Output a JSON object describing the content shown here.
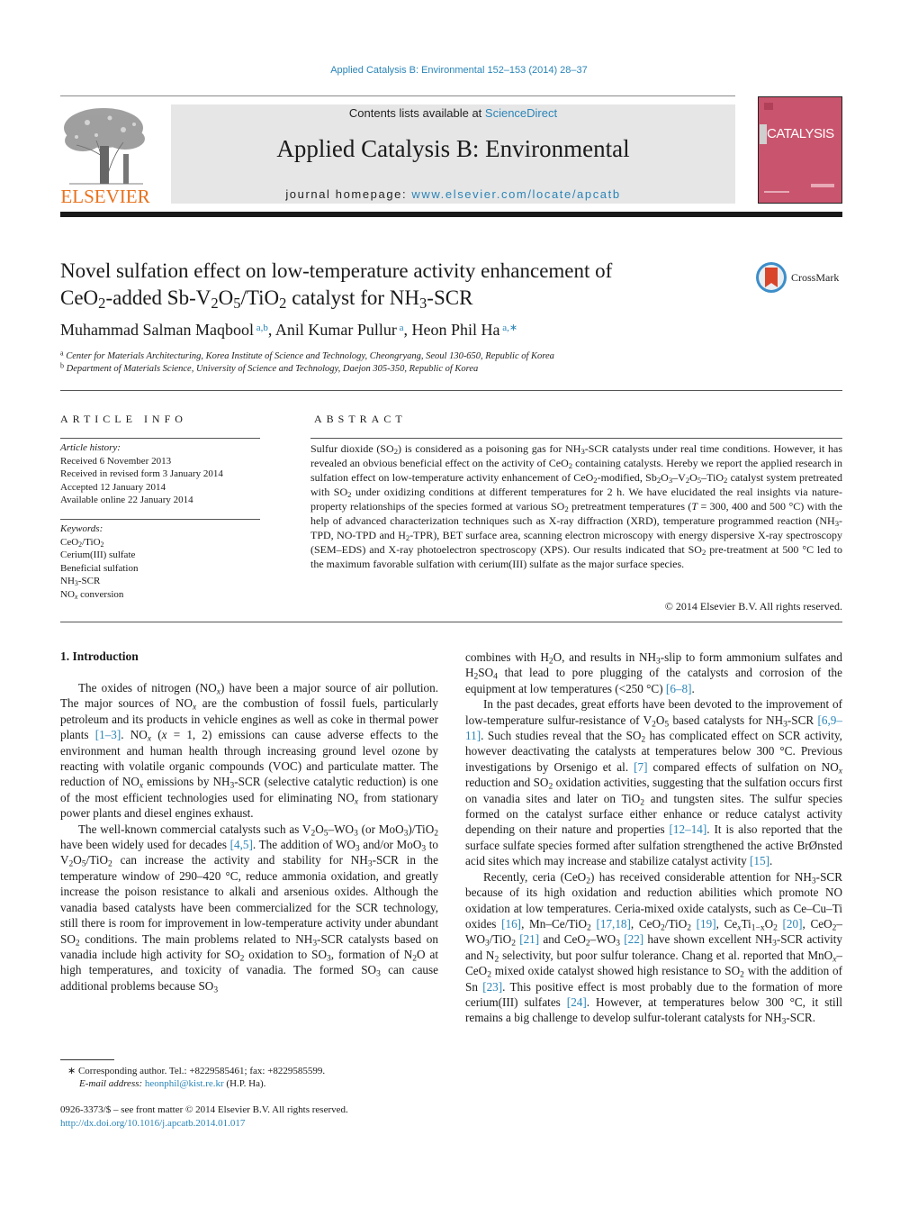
{
  "header": {
    "citation": "Applied Catalysis B: Environmental 152–153 (2014) 28–37",
    "contents_prefix": "Contents lists available at ",
    "contents_link": "ScienceDirect",
    "journal_title": "Applied Catalysis B: Environmental",
    "homepage_prefix": "journal homepage: ",
    "homepage_link": "www.elsevier.com/locate/apcatb",
    "publisher_logo_text": "ELSEVIER",
    "cover_title": "CATALYSIS",
    "crossmark_label": "CrossMark"
  },
  "colors": {
    "link": "#2a85b8",
    "elsevier_orange": "#e9711c",
    "cover_pink": "#c9546d",
    "masthead_gray": "#e6e6e6"
  },
  "article": {
    "title_line1": [
      {
        "t": "Novel sulfation effect on low-temperature activity enhancement of"
      }
    ],
    "title_line2": [
      {
        "t": "CeO"
      },
      {
        "t": "2",
        "sub": true
      },
      {
        "t": "-added Sb-V"
      },
      {
        "t": "2",
        "sub": true
      },
      {
        "t": "O"
      },
      {
        "t": "5",
        "sub": true
      },
      {
        "t": "/TiO"
      },
      {
        "t": "2",
        "sub": true
      },
      {
        "t": " catalyst for NH"
      },
      {
        "t": "3",
        "sub": true
      },
      {
        "t": "-SCR"
      }
    ],
    "authors": [
      {
        "t": "Muhammad Salman Maqbool"
      },
      {
        "t": " a,b",
        "sup": true
      },
      {
        "t": ", Anil Kumar Pullur"
      },
      {
        "t": " a",
        "sup": true
      },
      {
        "t": ", Heon Phil Ha"
      },
      {
        "t": " a,∗",
        "sup": true
      }
    ],
    "affiliations": [
      [
        {
          "t": "a",
          "sup": true
        },
        {
          "t": " Center for Materials Architecturing, Korea Institute of Science and Technology, Cheongryang, Seoul 130-650, Republic of Korea"
        }
      ],
      [
        {
          "t": "b",
          "sup": true
        },
        {
          "t": " Department of Materials Science, University of Science and Technology, Daejon 305-350, Republic of Korea"
        }
      ]
    ]
  },
  "article_info": {
    "heading": "ARTICLE INFO",
    "history_label": "Article history:",
    "history": [
      "Received 6 November 2013",
      "Received in revised form 3 January 2014",
      "Accepted 12 January 2014",
      "Available online 22 January 2014"
    ],
    "keywords_label": "Keywords:",
    "keywords": [
      [
        {
          "t": "CeO"
        },
        {
          "t": "2",
          "sub": true
        },
        {
          "t": "/TiO"
        },
        {
          "t": "2",
          "sub": true
        }
      ],
      [
        {
          "t": "Cerium(III) sulfate"
        }
      ],
      [
        {
          "t": "Beneficial sulfation"
        }
      ],
      [
        {
          "t": "NH"
        },
        {
          "t": "3",
          "sub": true
        },
        {
          "t": "-SCR"
        }
      ],
      [
        {
          "t": "NO"
        },
        {
          "t": "x",
          "sub": true,
          "i": true
        },
        {
          "t": " conversion"
        }
      ]
    ]
  },
  "abstract": {
    "heading": "ABSTRACT",
    "text": [
      {
        "t": "Sulfur dioxide (SO"
      },
      {
        "t": "2",
        "sub": true
      },
      {
        "t": ") is considered as a poisoning gas for NH"
      },
      {
        "t": "3",
        "sub": true
      },
      {
        "t": "-SCR catalysts under real time conditions. However, it has revealed an obvious beneficial effect on the activity of CeO"
      },
      {
        "t": "2",
        "sub": true
      },
      {
        "t": " containing catalysts. Hereby we report the applied research in sulfation effect on low-temperature activity enhancement of CeO"
      },
      {
        "t": "2",
        "sub": true
      },
      {
        "t": "-modified, Sb"
      },
      {
        "t": "2",
        "sub": true
      },
      {
        "t": "O"
      },
      {
        "t": "3",
        "sub": true
      },
      {
        "t": "–V"
      },
      {
        "t": "2",
        "sub": true
      },
      {
        "t": "O"
      },
      {
        "t": "5",
        "sub": true
      },
      {
        "t": "–TiO"
      },
      {
        "t": "2",
        "sub": true
      },
      {
        "t": " catalyst system pretreated with SO"
      },
      {
        "t": "2",
        "sub": true
      },
      {
        "t": " under oxidizing conditions at different temperatures for 2 h. We have elucidated the real insights via nature-property relationships of the species formed at various SO"
      },
      {
        "t": "2",
        "sub": true
      },
      {
        "t": " pretreatment temperatures ("
      },
      {
        "t": "T",
        "i": true
      },
      {
        "t": " = 300, 400 and 500 °C) with the help of advanced characterization techniques such as X-ray diffraction (XRD), temperature programmed reaction (NH"
      },
      {
        "t": "3",
        "sub": true
      },
      {
        "t": "-TPD, NO-TPD and H"
      },
      {
        "t": "2",
        "sub": true
      },
      {
        "t": "-TPR), BET surface area, scanning electron microscopy with energy dispersive X-ray spectroscopy (SEM–EDS) and X-ray photoelectron spectroscopy (XPS). Our results indicated that SO"
      },
      {
        "t": "2",
        "sub": true
      },
      {
        "t": " pre-treatment at 500 °C led to the maximum favorable sulfation with cerium(III) sulfate as the major surface species."
      }
    ],
    "copyright": "© 2014 Elsevier B.V. All rights reserved."
  },
  "introduction": {
    "heading": "1.  Introduction",
    "left_paragraphs": [
      [
        {
          "t": "The oxides of nitrogen (NO"
        },
        {
          "t": "x",
          "sub": true,
          "i": true
        },
        {
          "t": ") have been a major source of air pollution. The major sources of NO"
        },
        {
          "t": "x",
          "sub": true,
          "i": true
        },
        {
          "t": " are the combustion of fossil fuels, particularly petroleum and its products in vehicle engines as well as coke in thermal power plants "
        },
        {
          "t": "[1–3]",
          "link": true
        },
        {
          "t": ". NO"
        },
        {
          "t": "x",
          "sub": true,
          "i": true
        },
        {
          "t": " ("
        },
        {
          "t": "x",
          "i": true
        },
        {
          "t": " = 1, 2) emissions can cause adverse effects to the environment and human health through increasing ground level ozone by reacting with volatile organic compounds (VOC) and particulate matter. The reduction of NO"
        },
        {
          "t": "x",
          "sub": true,
          "i": true
        },
        {
          "t": " emissions by NH"
        },
        {
          "t": "3",
          "sub": true
        },
        {
          "t": "-SCR (selective catalytic reduction) is one of the most efficient technologies used for eliminating NO"
        },
        {
          "t": "x",
          "sub": true,
          "i": true
        },
        {
          "t": " from stationary power plants and diesel engines exhaust."
        }
      ],
      [
        {
          "t": "The well-known commercial catalysts such as V"
        },
        {
          "t": "2",
          "sub": true
        },
        {
          "t": "O"
        },
        {
          "t": "5",
          "sub": true
        },
        {
          "t": "–WO"
        },
        {
          "t": "3",
          "sub": true
        },
        {
          "t": " (or MoO"
        },
        {
          "t": "3",
          "sub": true
        },
        {
          "t": ")/TiO"
        },
        {
          "t": "2",
          "sub": true
        },
        {
          "t": " have been widely used for decades "
        },
        {
          "t": "[4,5]",
          "link": true
        },
        {
          "t": ". The addition of WO"
        },
        {
          "t": "3",
          "sub": true
        },
        {
          "t": " and/or MoO"
        },
        {
          "t": "3",
          "sub": true
        },
        {
          "t": " to V"
        },
        {
          "t": "2",
          "sub": true
        },
        {
          "t": "O"
        },
        {
          "t": "5",
          "sub": true
        },
        {
          "t": "/TiO"
        },
        {
          "t": "2",
          "sub": true
        },
        {
          "t": " can increase the activity and stability for NH"
        },
        {
          "t": "3",
          "sub": true
        },
        {
          "t": "-SCR in the temperature window of 290–420 °C, reduce ammonia oxidation, and greatly increase the poison resistance to alkali and arsenious oxides. Although the vanadia based catalysts have been commercialized for the SCR technology, still there is room for improvement in low-temperature activity under abundant SO"
        },
        {
          "t": "2",
          "sub": true
        },
        {
          "t": " conditions. The main problems related to NH"
        },
        {
          "t": "3",
          "sub": true
        },
        {
          "t": "-SCR catalysts based on vanadia include high activity for SO"
        },
        {
          "t": "2",
          "sub": true
        },
        {
          "t": " oxidation to SO"
        },
        {
          "t": "3",
          "sub": true
        },
        {
          "t": ", formation of N"
        },
        {
          "t": "2",
          "sub": true
        },
        {
          "t": "O at high temperatures, and toxicity of vanadia. The formed SO"
        },
        {
          "t": "3",
          "sub": true
        },
        {
          "t": " can cause additional problems because SO"
        },
        {
          "t": "3",
          "sub": true
        }
      ]
    ],
    "right_paragraphs": [
      [
        {
          "t": "combines with H"
        },
        {
          "t": "2",
          "sub": true
        },
        {
          "t": "O, and results in NH"
        },
        {
          "t": "3",
          "sub": true
        },
        {
          "t": "-slip to form ammonium sulfates and H"
        },
        {
          "t": "2",
          "sub": true
        },
        {
          "t": "SO"
        },
        {
          "t": "4",
          "sub": true
        },
        {
          "t": " that lead to pore plugging of the catalysts and corrosion of the equipment at low temperatures (<250 °C) "
        },
        {
          "t": "[6–8]",
          "link": true
        },
        {
          "t": "."
        }
      ],
      [
        {
          "t": "In the past decades, great efforts have been devoted to the improvement of low-temperature sulfur-resistance of V"
        },
        {
          "t": "2",
          "sub": true
        },
        {
          "t": "O"
        },
        {
          "t": "5",
          "sub": true
        },
        {
          "t": " based catalysts for NH"
        },
        {
          "t": "3",
          "sub": true
        },
        {
          "t": "-SCR "
        },
        {
          "t": "[6,9–11]",
          "link": true
        },
        {
          "t": ". Such studies reveal that the SO"
        },
        {
          "t": "2",
          "sub": true
        },
        {
          "t": " has complicated effect on SCR activity, however deactivating the catalysts at temperatures below 300 °C. Previous investigations by Orsenigo et al. "
        },
        {
          "t": "[7]",
          "link": true
        },
        {
          "t": " compared effects of sulfation on NO"
        },
        {
          "t": "x",
          "sub": true,
          "i": true
        },
        {
          "t": " reduction and SO"
        },
        {
          "t": "2",
          "sub": true
        },
        {
          "t": " oxidation activities, suggesting that the sulfation occurs first on vanadia sites and later on TiO"
        },
        {
          "t": "2",
          "sub": true
        },
        {
          "t": " and tungsten sites. The sulfur species formed on the catalyst surface either enhance or reduce catalyst activity depending on their nature and properties "
        },
        {
          "t": "[12–14]",
          "link": true
        },
        {
          "t": ". It is also reported that the surface sulfate species formed after sulfation strengthened the active BrØnsted acid sites which may increase and stabilize catalyst activity "
        },
        {
          "t": "[15]",
          "link": true
        },
        {
          "t": "."
        }
      ],
      [
        {
          "t": "Recently, ceria (CeO"
        },
        {
          "t": "2",
          "sub": true
        },
        {
          "t": ") has received considerable attention for NH"
        },
        {
          "t": "3",
          "sub": true
        },
        {
          "t": "-SCR because of its high oxidation and reduction abilities which promote NO oxidation at low temperatures. Ceria-mixed oxide catalysts, such as Ce–Cu–Ti oxides "
        },
        {
          "t": "[16]",
          "link": true
        },
        {
          "t": ", Mn–Ce/TiO"
        },
        {
          "t": "2",
          "sub": true
        },
        {
          "t": " "
        },
        {
          "t": "[17,18]",
          "link": true
        },
        {
          "t": ", CeO"
        },
        {
          "t": "2",
          "sub": true
        },
        {
          "t": "/TiO"
        },
        {
          "t": "2",
          "sub": true
        },
        {
          "t": " "
        },
        {
          "t": "[19]",
          "link": true
        },
        {
          "t": ", Ce"
        },
        {
          "t": "x",
          "sub": true,
          "i": true
        },
        {
          "t": "Ti"
        },
        {
          "t": "1−x",
          "sub": true
        },
        {
          "t": "O"
        },
        {
          "t": "2",
          "sub": true
        },
        {
          "t": " "
        },
        {
          "t": "[20]",
          "link": true
        },
        {
          "t": ", CeO"
        },
        {
          "t": "2",
          "sub": true
        },
        {
          "t": "–WO"
        },
        {
          "t": "3",
          "sub": true
        },
        {
          "t": "/TiO"
        },
        {
          "t": "2",
          "sub": true
        },
        {
          "t": " "
        },
        {
          "t": "[21]",
          "link": true
        },
        {
          "t": " and CeO"
        },
        {
          "t": "2",
          "sub": true
        },
        {
          "t": "–WO"
        },
        {
          "t": "3",
          "sub": true
        },
        {
          "t": " "
        },
        {
          "t": "[22]",
          "link": true
        },
        {
          "t": " have shown excellent NH"
        },
        {
          "t": "3",
          "sub": true
        },
        {
          "t": "-SCR activity and N"
        },
        {
          "t": "2",
          "sub": true
        },
        {
          "t": " selectivity, but poor sulfur tolerance. Chang et al. reported that MnO"
        },
        {
          "t": "x",
          "sub": true,
          "i": true
        },
        {
          "t": "–CeO"
        },
        {
          "t": "2",
          "sub": true
        },
        {
          "t": " mixed oxide catalyst showed high resistance to SO"
        },
        {
          "t": "2",
          "sub": true
        },
        {
          "t": " with the addition of Sn "
        },
        {
          "t": "[23]",
          "link": true
        },
        {
          "t": ". This positive effect is most probably due to the formation of more cerium(III) sulfates "
        },
        {
          "t": "[24]",
          "link": true
        },
        {
          "t": ". However, at temperatures below 300 °C, it still remains a big challenge to develop sulfur-tolerant catalysts for NH"
        },
        {
          "t": "3",
          "sub": true
        },
        {
          "t": "-SCR."
        }
      ]
    ]
  },
  "footnotes": {
    "corresponding": "∗  Corresponding author. Tel.: +8229585461; fax: +8229585599.",
    "email_label": "E-mail address: ",
    "email": "heonphil@kist.re.kr",
    "email_suffix": " (H.P. Ha).",
    "issn_line": "0926-3373/$ – see front matter © 2014 Elsevier B.V. All rights reserved.",
    "doi": "http://dx.doi.org/10.1016/j.apcatb.2014.01.017"
  }
}
